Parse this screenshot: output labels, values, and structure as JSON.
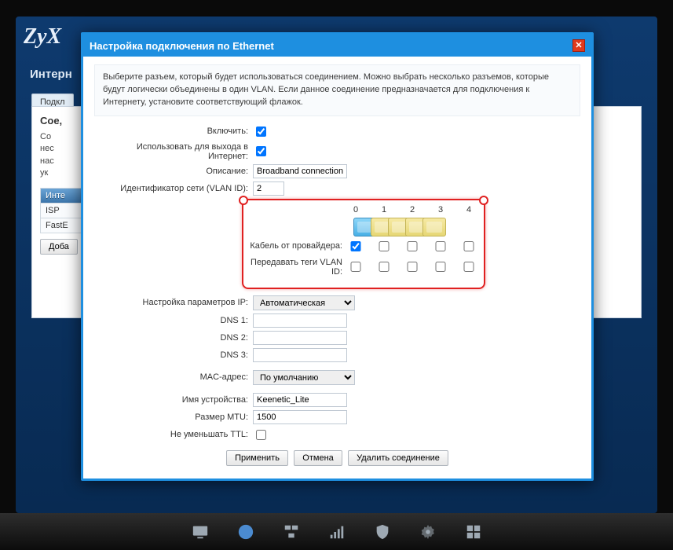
{
  "brand": "ZyX",
  "page_title_partial": "Интерн",
  "tab_label": "Подкл",
  "panel": {
    "heading": "Сое,",
    "text_lines": [
      "Со",
      "нес",
      "нас",
      "ук"
    ]
  },
  "sidebar": {
    "items": [
      "Инте",
      "ISP",
      "FastE"
    ],
    "add_btn": "Доба"
  },
  "modal": {
    "title": "Настройка подключения по Ethernet",
    "instruction": "Выберите разъем, который будет использоваться соединением. Можно выбрать несколько разъемов, которые будут логически объединены в один VLAN. Если данное соединение предназначается для подключения к Интернету, установите соответствующий флажок.",
    "labels": {
      "enable": "Включить:",
      "use_internet": "Использовать для выхода в Интернет:",
      "description": "Описание:",
      "vlan_id": "Идентификатор сети (VLAN ID):",
      "provider_cable": "Кабель от провайдера:",
      "vlan_tags": "Передавать теги VLAN ID:",
      "ip_settings": "Настройка параметров IP:",
      "dns1": "DNS 1:",
      "dns2": "DNS 2:",
      "dns3": "DNS 3:",
      "mac": "MAC-адрес:",
      "device_name": "Имя устройства:",
      "mtu": "Размер MTU:",
      "no_ttl": "Не уменьшать TTL:"
    },
    "values": {
      "enable": true,
      "use_internet": true,
      "description": "Broadband connection",
      "vlan_id": "2",
      "port_numbers": [
        "0",
        "1",
        "2",
        "3",
        "4"
      ],
      "provider_cable": [
        true,
        false,
        false,
        false,
        false
      ],
      "vlan_tags": [
        false,
        false,
        false,
        false,
        false
      ],
      "ip_settings": "Автоматическая",
      "dns1": "",
      "dns2": "",
      "dns3": "",
      "mac": "По умолчанию",
      "device_name": "Keenetic_Lite",
      "mtu": "1500",
      "no_ttl": false
    },
    "buttons": {
      "apply": "Применить",
      "cancel": "Отмена",
      "delete": "Удалить соединение"
    }
  }
}
